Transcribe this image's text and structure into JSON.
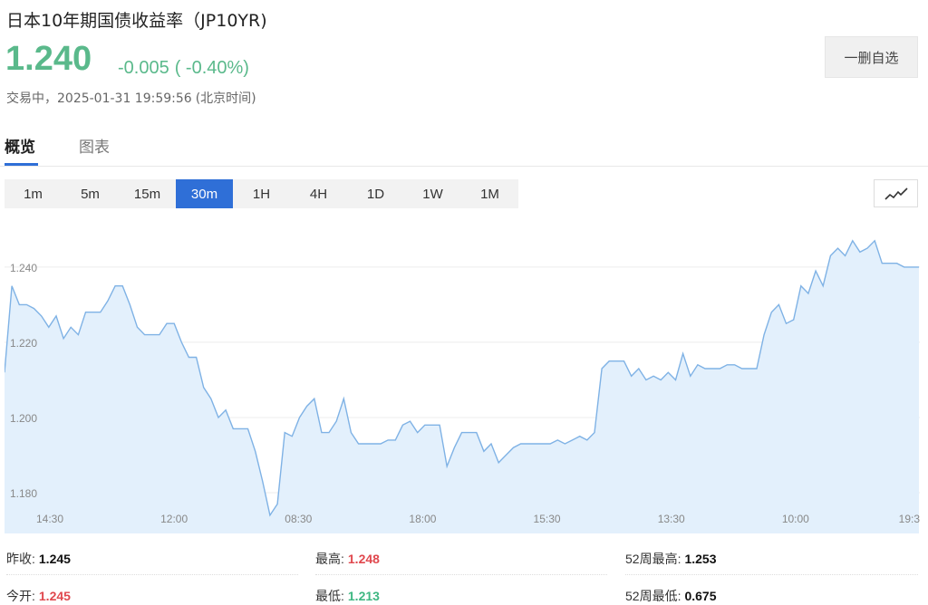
{
  "header": {
    "title": "日本10年期国债收益率（JP10YR)",
    "price": "1.240",
    "change": "-0.005",
    "change_pct": "( -0.40%)",
    "status_label": "交易中，",
    "timestamp": "2025-01-31 19:59:56",
    "timezone": "(北京时间)",
    "unfollow_label": "一删自选"
  },
  "tabs": [
    {
      "label": "概览",
      "active": true
    },
    {
      "label": "图表",
      "active": false
    }
  ],
  "intervals": {
    "items": [
      "1m",
      "5m",
      "15m",
      "30m",
      "1H",
      "4H",
      "1D",
      "1W",
      "1M"
    ],
    "selected": "30m"
  },
  "chart_type_icon": "line-chart-icon",
  "colors": {
    "up": "#e0484e",
    "down": "#5ab98b",
    "accent": "#2f6fd7",
    "line": "#7fb2e5",
    "fill": "#e3f0fc"
  },
  "chart_data": {
    "type": "area",
    "title": "",
    "xlabel": "",
    "ylabel": "",
    "ylim": [
      1.1735,
      1.2525
    ],
    "yticks": [
      1.18,
      1.2,
      1.22,
      1.24
    ],
    "ytick_labels": [
      "1.180",
      "1.200",
      "1.220",
      "1.240"
    ],
    "xtick_labels": [
      "14:30",
      "12:00",
      "08:30",
      "18:00",
      "15:30",
      "13:30",
      "10:00",
      "19:3"
    ],
    "grid": true,
    "series": [
      {
        "values": [
          1.212,
          1.235,
          1.23,
          1.23,
          1.229,
          1.227,
          1.224,
          1.227,
          1.221,
          1.224,
          1.222,
          1.228,
          1.228,
          1.228,
          1.231,
          1.235,
          1.235,
          1.23,
          1.224,
          1.222,
          1.222,
          1.222,
          1.225,
          1.225,
          1.22,
          1.216,
          1.216,
          1.208,
          1.205,
          1.2,
          1.202,
          1.197,
          1.197,
          1.197,
          1.191,
          1.183,
          1.174,
          1.177,
          1.196,
          1.195,
          1.2,
          1.203,
          1.205,
          1.196,
          1.196,
          1.199,
          1.205,
          1.196,
          1.193,
          1.193,
          1.193,
          1.193,
          1.194,
          1.194,
          1.198,
          1.199,
          1.196,
          1.198,
          1.198,
          1.198,
          1.187,
          1.192,
          1.196,
          1.196,
          1.196,
          1.191,
          1.193,
          1.188,
          1.19,
          1.192,
          1.193,
          1.193,
          1.193,
          1.193,
          1.193,
          1.194,
          1.193,
          1.194,
          1.195,
          1.194,
          1.196,
          1.213,
          1.215,
          1.215,
          1.215,
          1.211,
          1.213,
          1.21,
          1.211,
          1.21,
          1.212,
          1.21,
          1.217,
          1.211,
          1.214,
          1.213,
          1.213,
          1.213,
          1.214,
          1.214,
          1.213,
          1.213,
          1.213,
          1.222,
          1.228,
          1.23,
          1.225,
          1.226,
          1.235,
          1.233,
          1.239,
          1.235,
          1.243,
          1.245,
          1.243,
          1.247,
          1.244,
          1.245,
          1.247,
          1.241,
          1.241,
          1.241,
          1.24,
          1.24,
          1.24
        ]
      }
    ]
  },
  "stats": {
    "prev_close": {
      "label": "昨收:",
      "value": "1.245"
    },
    "high": {
      "label": "最高:",
      "value": "1.248"
    },
    "high_52w": {
      "label": "52周最高:",
      "value": "1.253"
    },
    "open": {
      "label": "今开:",
      "value": "1.245"
    },
    "low": {
      "label": "最低:",
      "value": "1.213"
    },
    "low_52w": {
      "label": "52周最低:",
      "value": "0.675"
    }
  }
}
